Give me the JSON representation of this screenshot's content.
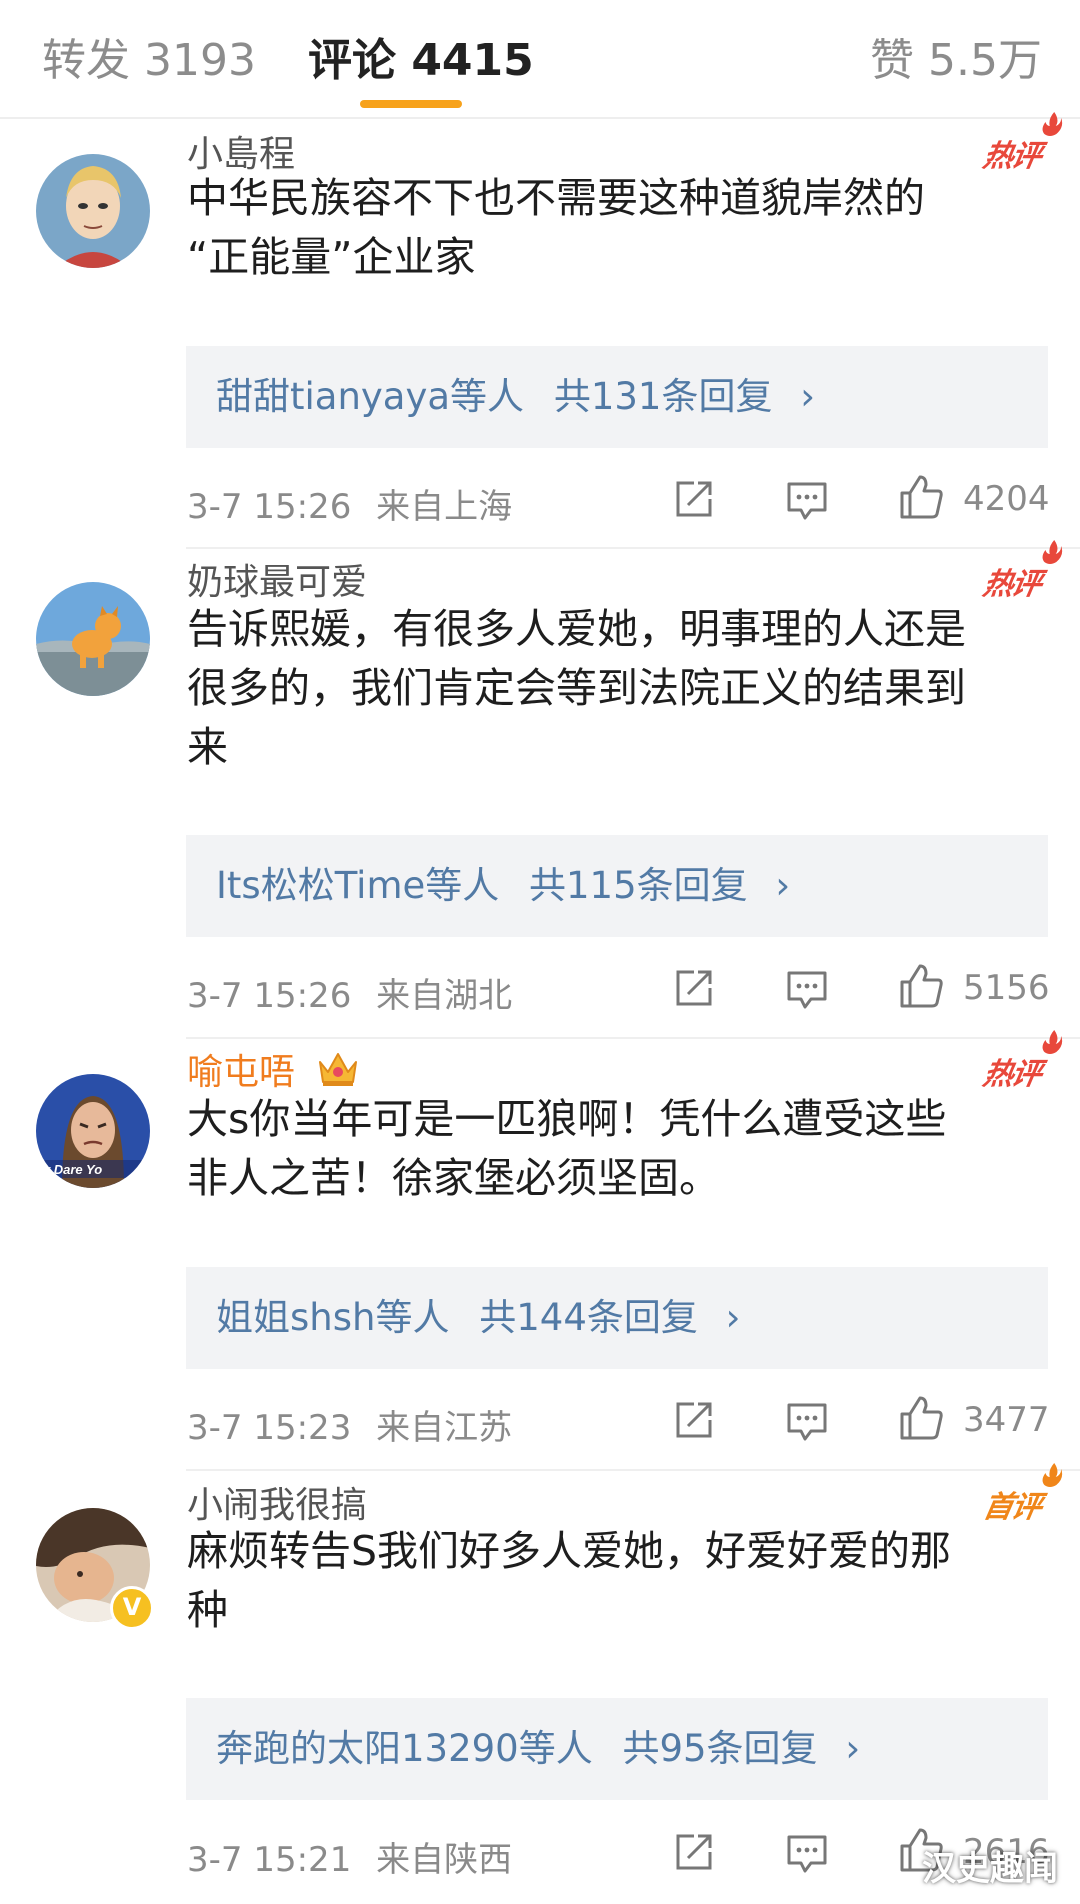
{
  "tabs": {
    "repost": "转发 3193",
    "comments": "评论 4415",
    "likes": "赞 5.5万"
  },
  "comments": [
    {
      "username": "小島程",
      "badge": "热评",
      "lines": [
        "中华民族容不下也不需要这种道貌岸然的",
        "“正能量”企业家"
      ],
      "reply_users": "甜甜tianyaya等人",
      "reply_count": "共131条回复",
      "time": "3-7 15:26",
      "location": "来自上海",
      "likes": "4204"
    },
    {
      "username": "奶球最可爱",
      "badge": "热评",
      "lines": [
        "告诉熙媛，有很多人爱她，明事理的人还是",
        "很多的，我们肯定会等到法院正义的结果到",
        "来"
      ],
      "reply_users": "Its松松Time等人",
      "reply_count": "共115条回复",
      "time": "3-7 15:26",
      "location": "来自湖北",
      "likes": "5156"
    },
    {
      "username": "喻屯唔",
      "badge": "热评",
      "avatar_text": "w Dare Yo",
      "lines": [
        "大s你当年可是一匹狼啊！凭什么遭受这些",
        "非人之苦！徐家堡必须坚固。"
      ],
      "reply_users": "姐姐shsh等人",
      "reply_count": "共144条回复",
      "time": "3-7 15:23",
      "location": "来自江苏",
      "likes": "3477"
    },
    {
      "username": "小闹我很搞",
      "badge": "首评",
      "verified_mark": "V",
      "lines": [
        "麻烦转告S我们好多人爱她，好爱好爱的那",
        "种"
      ],
      "reply_users": "奔跑的太阳13290等人",
      "reply_count": "共95条回复",
      "time": "3-7 15:21",
      "location": "来自陕西",
      "likes": "2616"
    }
  ],
  "chevron": "›",
  "watermark": "汉史趣闻",
  "colors": {
    "accent": "#f7a21b",
    "link": "#527aa5",
    "hot": "#e8483b",
    "first": "#f0861a",
    "vip_name": "#f07c1e"
  }
}
